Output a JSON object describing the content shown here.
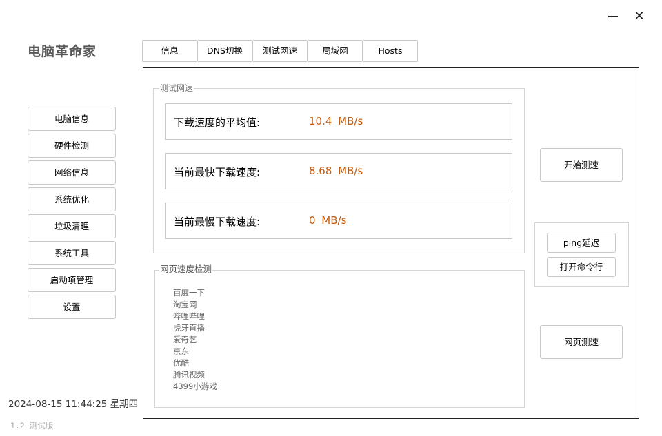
{
  "window": {
    "minimize_glyph": "",
    "close_glyph": "✕"
  },
  "app": {
    "title": "电脑革命家"
  },
  "sidebar": {
    "items": [
      {
        "label": "电脑信息"
      },
      {
        "label": "硬件检测"
      },
      {
        "label": "网络信息"
      },
      {
        "label": "系统优化"
      },
      {
        "label": "垃圾清理"
      },
      {
        "label": "系统工具"
      },
      {
        "label": "启动项管理"
      },
      {
        "label": "设置"
      }
    ]
  },
  "footer": {
    "datetime": "2024-08-15 11:44:25  星期四",
    "version": "1.2  测试版"
  },
  "tabs": [
    {
      "label": "信息"
    },
    {
      "label": "DNS切换"
    },
    {
      "label": "测试网速"
    },
    {
      "label": "局域网"
    },
    {
      "label": "Hosts"
    }
  ],
  "speed_test": {
    "group_title": "测试网速",
    "rows": [
      {
        "label": "下载速度的平均值:",
        "value": "10.4  MB/s"
      },
      {
        "label": "当前最快下载速度:",
        "value": "8.68  MB/s"
      },
      {
        "label": "当前最慢下载速度:",
        "value": "0  MB/s"
      }
    ]
  },
  "web_speed": {
    "group_title": "网页速度检测",
    "sites": [
      "百度一下",
      "淘宝网",
      "哔哩哔哩",
      "虎牙直播",
      "爱奇艺",
      "京东",
      "优酷",
      "腾讯视频",
      "4399小游戏"
    ]
  },
  "actions": {
    "start_label": "开始测速",
    "ping_label": "ping延迟",
    "cmd_label": "打开命令行",
    "web_label": "网页测速"
  },
  "colors": {
    "accent_value": "#c35a0c",
    "border": "#c8c8c8",
    "title_gray": "#595959"
  }
}
